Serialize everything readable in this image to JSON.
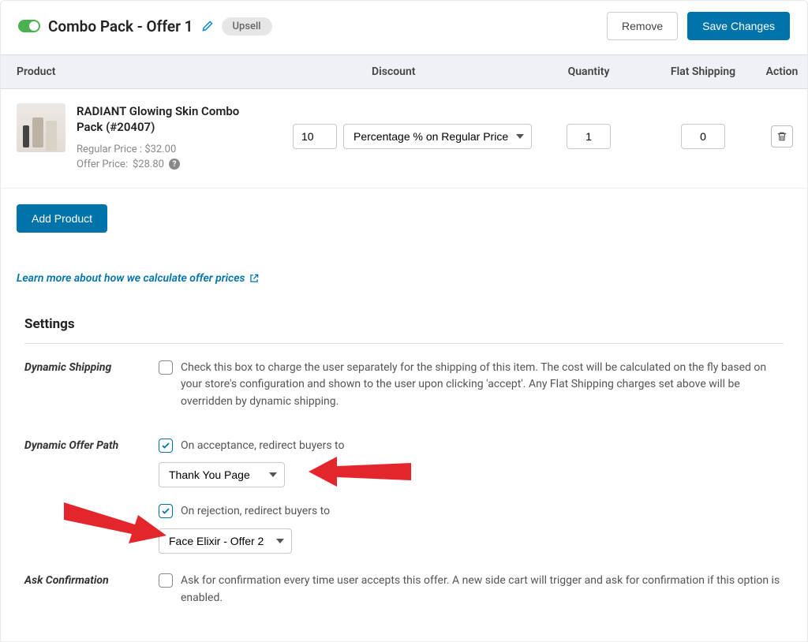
{
  "header": {
    "title": "Combo Pack - Offer 1",
    "badge": "Upsell",
    "remove_label": "Remove",
    "save_label": "Save Changes"
  },
  "table": {
    "columns": {
      "product": "Product",
      "discount": "Discount",
      "quantity": "Quantity",
      "flat_shipping": "Flat Shipping",
      "action": "Action"
    }
  },
  "product": {
    "name": "RADIANT Glowing Skin Combo Pack (#20407)",
    "regular_price_label": "Regular Price :",
    "regular_price": "$32.00",
    "offer_price_label": "Offer Price:",
    "offer_price": "$28.80",
    "discount_value": "10",
    "discount_type": "Percentage % on Regular Price",
    "quantity": "1",
    "flat_shipping": "0"
  },
  "buttons": {
    "add_product": "Add Product"
  },
  "learn_more": "Learn more about how we calculate offer prices",
  "settings": {
    "title": "Settings",
    "dynamic_shipping": {
      "label": "Dynamic Shipping",
      "text": "Check this box to charge the user separately for the shipping of this item. The cost will be calculated on the fly based on your store's configuration and shown to the user upon clicking 'accept'. Any Flat Shipping charges set above will be overridden by dynamic shipping."
    },
    "dynamic_offer_path": {
      "label": "Dynamic Offer Path",
      "accept_text": "On acceptance, redirect buyers to",
      "accept_select": "Thank You Page",
      "reject_text": "On rejection, redirect buyers to",
      "reject_select": "Face Elixir - Offer 2"
    },
    "ask_confirmation": {
      "label": "Ask Confirmation",
      "text": "Ask for confirmation every time user accepts this offer. A new side cart will trigger and ask for confirmation if this option is enabled."
    }
  }
}
